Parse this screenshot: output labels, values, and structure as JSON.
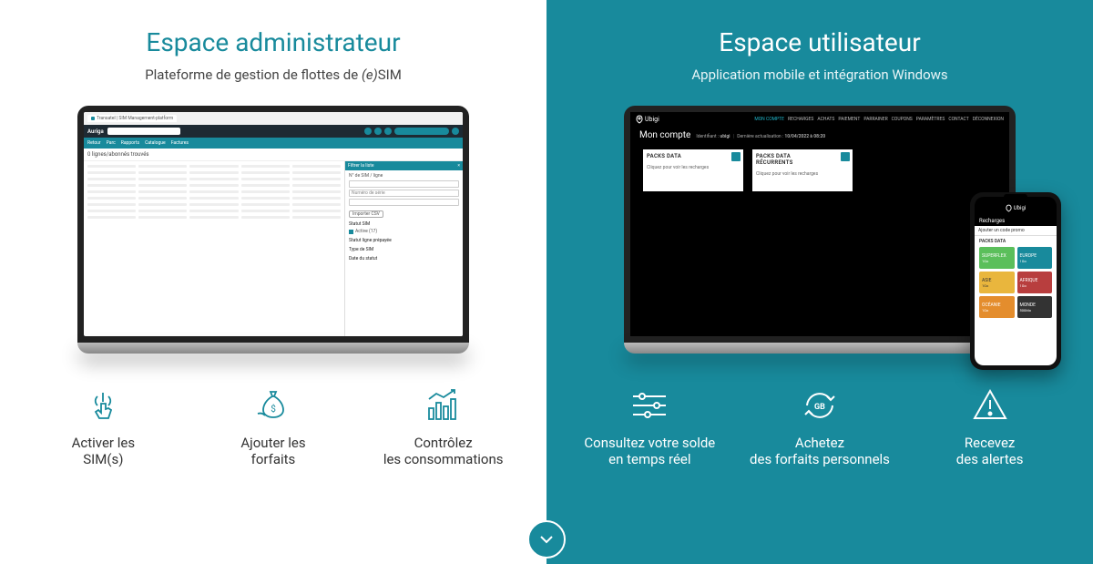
{
  "left": {
    "title": "Espace administrateur",
    "subtitle_prefix": "Plateforme de gestion de flottes de ",
    "subtitle_em": "(e)",
    "subtitle_suffix": "SIM",
    "laptop": {
      "tab_title": "Transatel | SIM Management-platform",
      "brand": "Auriga",
      "back_label": "Retour",
      "nav_parc": "Parc",
      "nav_rapports": "Rapports",
      "nav_catalogue": "Catalogue",
      "nav_factures": "Factures",
      "results_text": "0 lignes/abonnés trouvés",
      "filter_title": "Filtrer la liste",
      "filter_field1_label": "N° de SIM / ligne",
      "filter_field1_hint": "Numéro de série",
      "import_btn": "Importer CSV",
      "section_status": "Statut SIM",
      "status_active": "Active (17)",
      "section_line": "Statut ligne prépayée",
      "section_type": "Type de SIM",
      "section_date": "Date du statut"
    },
    "features": [
      {
        "label_l1": "Activer les",
        "label_l2": "SIM(s)"
      },
      {
        "label_l1": "Ajouter les",
        "label_l2": "forfaits"
      },
      {
        "label_l1": "Contrôlez",
        "label_l2": "les consommations"
      }
    ]
  },
  "right": {
    "title": "Espace utilisateur",
    "subtitle": "Application mobile et intégration Windows",
    "laptop": {
      "brand": "Ubigi",
      "nav": [
        "MON COMPTE",
        "RECHARGES",
        "ACHATS",
        "PAIEMENT",
        "PARRAINER",
        "COUPONS",
        "PARAMÈTRES",
        "CONTACT",
        "DÉCONNEXION"
      ],
      "account_title": "Mon compte",
      "id_label": "Identifiant :",
      "id_value": "ubigi",
      "updated_label": "Dernière actualisation :",
      "updated_value": "10/04/2022 à 08:20",
      "card1_title": "PACKS DATA",
      "card1_hint": "Cliquez pour voir les recharges",
      "card2_title_l1": "PACKS DATA",
      "card2_title_l2": "RÉCURRENTS",
      "card2_hint": "Cliquez pour voir les recharges"
    },
    "phone": {
      "brand": "Ubigi",
      "header": "Recharges",
      "refill_hint": "Ajouter un code promo",
      "section_label": "PACKS DATA",
      "tiles": [
        {
          "name": "SUPERFLEX",
          "price": "1Go"
        },
        {
          "name": "EUROPE",
          "price": "1Go"
        },
        {
          "name": "ASIE",
          "price": "1Go"
        },
        {
          "name": "AFRIQUE",
          "price": "1Go"
        },
        {
          "name": "OCÉANIE",
          "price": "1Go"
        },
        {
          "name": "MONDE",
          "price": "500Mo"
        }
      ]
    },
    "features": [
      {
        "label_l1": "Consultez votre solde",
        "label_l2": "en temps réel"
      },
      {
        "label_l1": "Achetez",
        "label_l2": "des forfaits personnels"
      },
      {
        "label_l1": "Recevez",
        "label_l2": "des alertes"
      }
    ]
  }
}
